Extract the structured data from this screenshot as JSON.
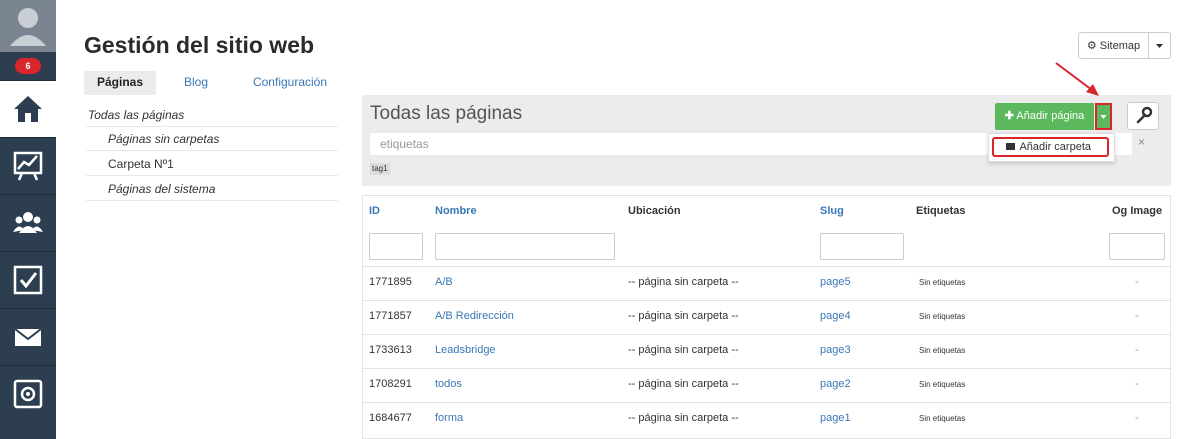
{
  "sidebar": {
    "notifications_count": "6",
    "items": [
      {
        "icon": "home-icon",
        "active": true
      },
      {
        "icon": "chart-icon",
        "active": false
      },
      {
        "icon": "users-icon",
        "active": false
      },
      {
        "icon": "checkbox-icon",
        "active": false
      },
      {
        "icon": "mail-icon",
        "active": false
      },
      {
        "icon": "safe-icon",
        "active": false
      }
    ]
  },
  "header": {
    "title": "Gestión del sitio web",
    "sitemap_label": "Sitemap",
    "tabs": [
      {
        "label": "Páginas"
      },
      {
        "label": "Blog"
      },
      {
        "label": "Configuración"
      }
    ]
  },
  "tree": {
    "items": [
      {
        "label": "Todas las páginas"
      },
      {
        "label": "Páginas sin carpetas"
      },
      {
        "label": "Carpeta Nº1"
      },
      {
        "label": "Páginas del sistema"
      }
    ]
  },
  "panel": {
    "title": "Todas las páginas",
    "add_page_label": "Añadir página",
    "tags_placeholder": "etiquetas",
    "clear_symbol": "×",
    "tag_chip": "tag1",
    "dropdown_item": "Añadir carpeta"
  },
  "table": {
    "headers": {
      "id": "ID",
      "name": "Nombre",
      "location": "Ubicación",
      "slug": "Slug",
      "tags": "Etiquetas",
      "og": "Og Image"
    },
    "rows": [
      {
        "id": "1771895",
        "name": "A/B",
        "location": "-- página sin carpeta --",
        "slug": "page5",
        "tags": "Sin etiquetas",
        "og": "-"
      },
      {
        "id": "1771857",
        "name": "A/B Redirección",
        "location": "-- página sin carpeta --",
        "slug": "page4",
        "tags": "Sin etiquetas",
        "og": "-"
      },
      {
        "id": "1733613",
        "name": "Leadsbridge",
        "location": "-- página sin carpeta --",
        "slug": "page3",
        "tags": "Sin etiquetas",
        "og": "-"
      },
      {
        "id": "1708291",
        "name": "todos",
        "location": "-- página sin carpeta --",
        "slug": "page2",
        "tags": "Sin etiquetas",
        "og": "-"
      },
      {
        "id": "1684677",
        "name": "forma",
        "location": "-- página sin carpeta --",
        "slug": "page1",
        "tags": "Sin etiquetas",
        "og": "-"
      }
    ]
  },
  "colors": {
    "sidebar_bg": "#2c3e50",
    "accent_green": "#5cb85c",
    "highlight_red": "#d9262b",
    "link_blue": "#3a78b6"
  }
}
